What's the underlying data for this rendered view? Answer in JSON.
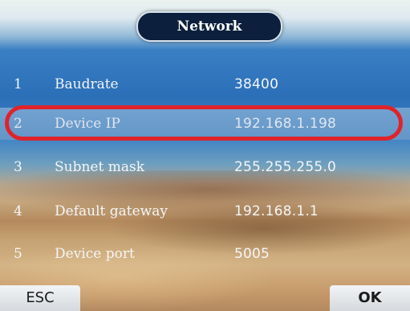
{
  "window": {
    "title": "Network"
  },
  "rows": [
    {
      "num": "1",
      "label": "Baudrate",
      "value": "38400"
    },
    {
      "num": "2",
      "label": "Device IP",
      "value": "192.168.1.198"
    },
    {
      "num": "3",
      "label": "Subnet mask",
      "value": "255.255.255.0"
    },
    {
      "num": "4",
      "label": "Default gateway",
      "value": "192.168.1.1"
    },
    {
      "num": "5",
      "label": "Device port",
      "value": "5005"
    }
  ],
  "buttons": {
    "esc": "ESC",
    "ok": "OK"
  },
  "colors": {
    "highlight": "#e0232a",
    "title_bg": "#0c1f3d"
  }
}
